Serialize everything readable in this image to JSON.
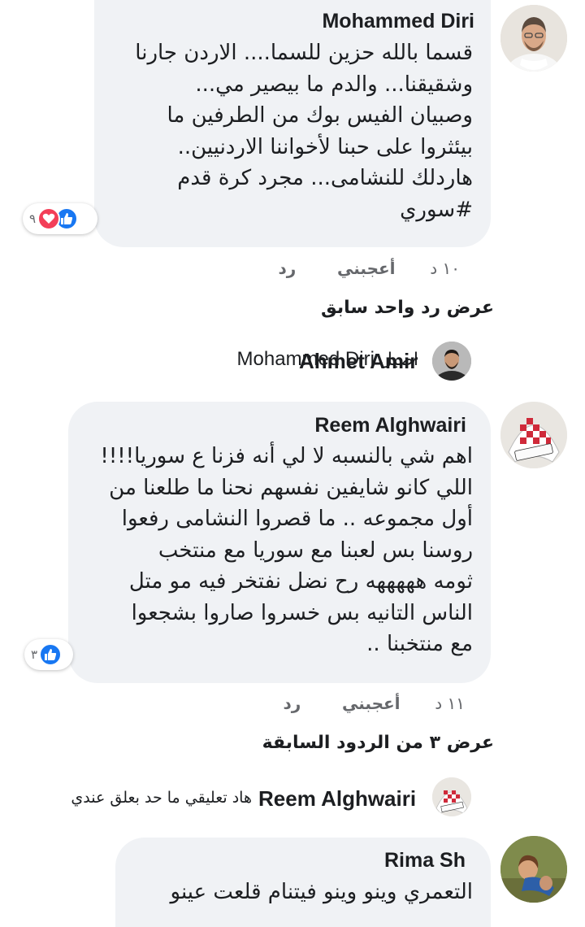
{
  "comments": [
    {
      "author": "Mohammed Diri",
      "text": "قسما بالله حزين للسما.... الاردن جارنا\nوشقيقنا...   والدم ما بيصير مي...\nوصبيان الفيس بوك من الطرفين ما\nبيئثروا على  حبنا لأخواننا الاردنيين..\nهاردلك للنشامى...  مجرد كرة قدم\n#سوري",
      "reaction_count": "٩",
      "time": "١٠ د",
      "like_label": "أعجبني",
      "reply_label": "رد"
    },
    {
      "author": "Reem Alghwairi",
      "text": "اهم شي بالنسبه لا لي أنه فزنا ع سوريا!!!!\nاللي كانو شايفين نفسهم نحنا ما طلعنا من\nأول مجموعه  .. ما قصروا النشامى رفعوا\nروسنا بس لعبنا مع سوريا مع منتخب\nثومه هههههه رح نضل نفتخر فيه مو متل\nالناس التانيه بس خسروا صاروا بشجعوا\nمع منتخبنا ..",
      "reaction_count": "٣",
      "time": "١١ د",
      "like_label": "أعجبني",
      "reply_label": "رد"
    },
    {
      "author": "Rima Sh",
      "text": "التعمري وينو وينو فيتنام قلعت عينو"
    }
  ],
  "view_prev_reply_1": "عرض رد واحد سابق",
  "reply_1": {
    "author": "Ahmet Amir",
    "word": "اصيل",
    "mention": "Mohammed Diri"
  },
  "view_prev_reply_2": "عرض ٣ من الردود السابقة",
  "reply_2": {
    "author": "Reem Alghwairi",
    "text": "هاد تعليقي ما حد بعلق عندي"
  },
  "colors": {
    "bubble": "#f0f2f5",
    "like_blue": "#1877f2",
    "love_red": "#f33e58",
    "meta_gray": "#65676b"
  },
  "icons": [
    "like-icon",
    "love-icon"
  ]
}
